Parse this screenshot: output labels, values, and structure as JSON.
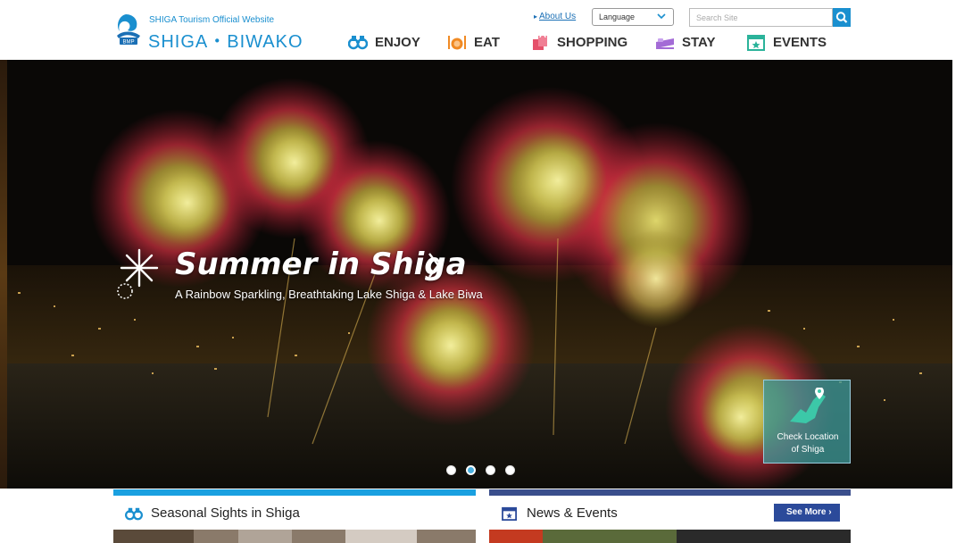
{
  "site": {
    "subtitle": "SHIGA Tourism Official Website",
    "title": "SHIGA・BIWAKO",
    "logo_badge": "BMP"
  },
  "header": {
    "about_label": "About Us",
    "language_label": "Language",
    "search_placeholder": "Search Site"
  },
  "nav": [
    {
      "label": "ENJOY",
      "icon": "binoculars-icon"
    },
    {
      "label": "EAT",
      "icon": "dining-icon"
    },
    {
      "label": "SHOPPING",
      "icon": "shopping-bag-icon"
    },
    {
      "label": "STAY",
      "icon": "bed-icon"
    },
    {
      "label": "EVENTS",
      "icon": "calendar-icon"
    }
  ],
  "hero": {
    "title": "Summer in Shiga",
    "subtitle": "A Rainbow Sparkling, Breathtaking Lake Shiga & Lake Biwa",
    "slide_count": 4,
    "active_slide": 2,
    "check_location_line1": "Check Location",
    "check_location_line2": "of Shiga"
  },
  "sections": {
    "seasonal": {
      "title": "Seasonal Sights in Shiga",
      "bar_color": "#1aa0e0"
    },
    "news": {
      "title": "News & Events",
      "bar_color": "#3a4e8c",
      "see_more": "See More"
    }
  },
  "colors": {
    "brand": "#1a8fcf",
    "nav_icon": "#1a8fcf",
    "eat_icon": "#f08a24",
    "shopping_icon": "#e5506a",
    "stay_icon": "#a36bd6",
    "events_icon": "#2bb39a"
  }
}
